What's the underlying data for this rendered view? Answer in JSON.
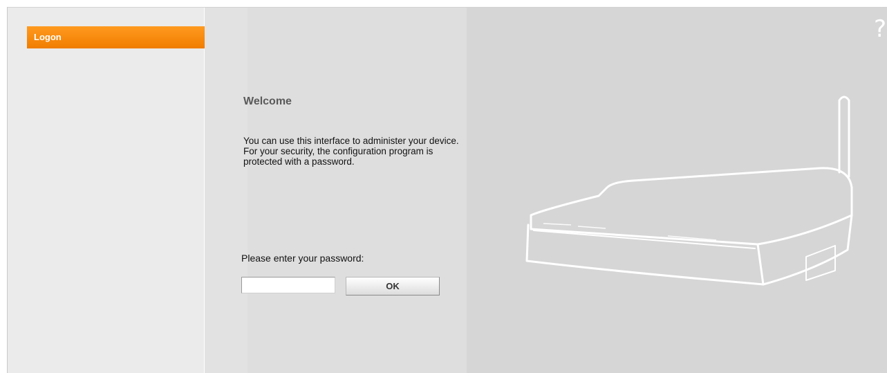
{
  "nav": {
    "items": [
      {
        "label": "Logon",
        "active": true
      }
    ],
    "accent_color": "#f28a00"
  },
  "main": {
    "title": "Welcome",
    "intro": "You can use this interface to administer your device. For your security, the configuration program is protected with a password.",
    "password_label": "Please enter your password:",
    "password_value": "",
    "ok_label": "OK"
  },
  "header": {
    "help_icon": "?"
  },
  "illustration": {
    "icon": "router-icon"
  }
}
